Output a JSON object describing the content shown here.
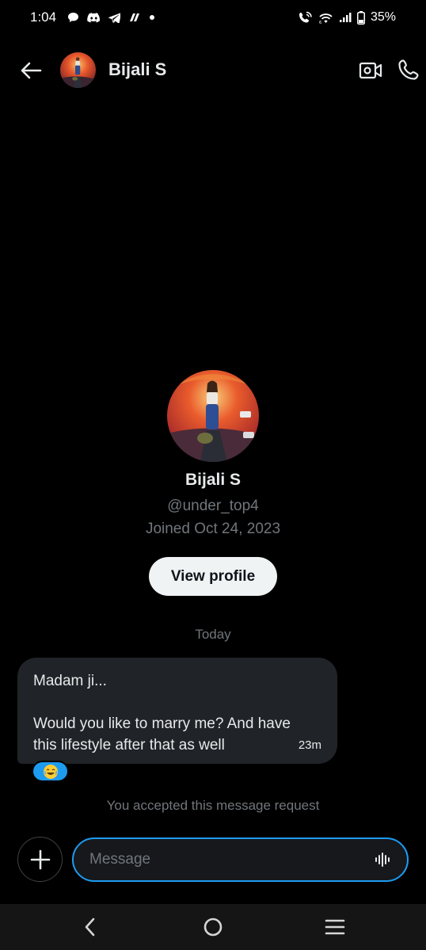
{
  "status_bar": {
    "time": "1:04",
    "battery": "35%",
    "left_icons": [
      "chat-bubble-icon",
      "discord-icon",
      "telegram-icon",
      "app-icon",
      "dot-icon"
    ],
    "right_icons": [
      "wifi-call-icon",
      "wifi-icon",
      "signal-icon",
      "battery-icon"
    ]
  },
  "header": {
    "name": "Bijali S",
    "icons": [
      "back-arrow-icon",
      "video-camera-icon",
      "phone-icon"
    ]
  },
  "profile": {
    "name": "Bijali S",
    "handle": "@under_top4",
    "joined": "Joined Oct 24, 2023",
    "view_profile_label": "View profile"
  },
  "conversation": {
    "date_separator": "Today",
    "messages": [
      {
        "line1": "Madam ji...",
        "line2": "Would you like to marry me? And have",
        "line3": "this lifestyle after that as well",
        "time": "23m",
        "reaction": "😂"
      }
    ],
    "accepted_note": "You accepted this message request"
  },
  "composer": {
    "placeholder": "Message",
    "icons": [
      "plus-icon",
      "voice-wave-icon"
    ]
  },
  "nav_bar": {
    "icons": [
      "nav-back-icon",
      "nav-home-icon",
      "nav-recents-icon"
    ]
  },
  "colors": {
    "accent": "#1d9bf0",
    "bubble": "#202327",
    "muted_text": "#71767b",
    "background": "#000000"
  }
}
